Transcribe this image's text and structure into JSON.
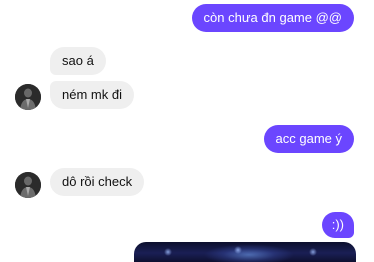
{
  "conversation": {
    "messages": [
      {
        "direction": "outgoing",
        "text": "còn chưa đn game @@"
      },
      {
        "direction": "incoming",
        "text": "sao á"
      },
      {
        "direction": "incoming",
        "text": "ném mk đi"
      },
      {
        "direction": "outgoing",
        "text": "acc game ý"
      },
      {
        "direction": "incoming",
        "text": "dô rồi check"
      },
      {
        "direction": "outgoing",
        "text": ":))"
      }
    ],
    "outgoing_color": "#6b46ff",
    "incoming_color": "#efefef"
  },
  "icons": {
    "avatar": "contact-avatar"
  }
}
